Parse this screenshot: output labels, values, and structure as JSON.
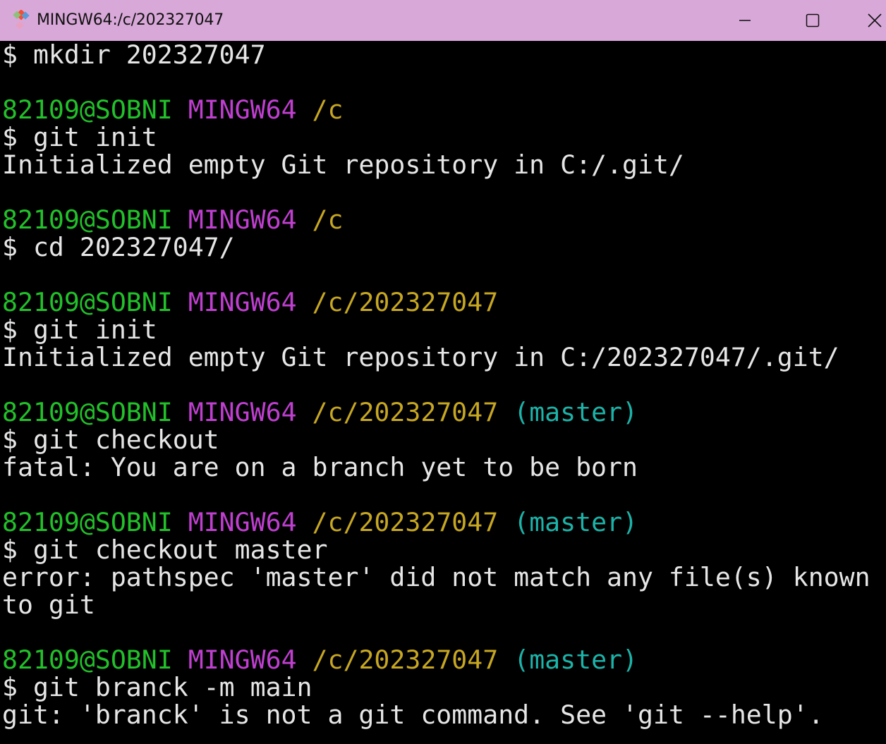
{
  "window": {
    "title": "MINGW64:/c/202327047",
    "colors": {
      "titlebar": "#d8a8d8",
      "background": "#000000",
      "text": "#e6e6e6",
      "user_host": "#22c02a",
      "system": "#bf3fd0",
      "path": "#c7a722",
      "branch": "#1cb3a9"
    }
  },
  "terminal": {
    "lines": [
      {
        "cmd": "$ mkdir 202327047"
      },
      {
        "blank": ""
      },
      {
        "user": "82109@SOBNI",
        "sys": "MINGW64",
        "path": "/c",
        "branch": ""
      },
      {
        "cmd": "$ git init"
      },
      {
        "out": "Initialized empty Git repository in C:/.git/"
      },
      {
        "blank": ""
      },
      {
        "user": "82109@SOBNI",
        "sys": "MINGW64",
        "path": "/c",
        "branch": ""
      },
      {
        "cmd": "$ cd 202327047/"
      },
      {
        "blank": ""
      },
      {
        "user": "82109@SOBNI",
        "sys": "MINGW64",
        "path": "/c/202327047",
        "branch": ""
      },
      {
        "cmd": "$ git init"
      },
      {
        "out": "Initialized empty Git repository in C:/202327047/.git/"
      },
      {
        "blank": ""
      },
      {
        "user": "82109@SOBNI",
        "sys": "MINGW64",
        "path": "/c/202327047",
        "branch": "(master)"
      },
      {
        "cmd": "$ git checkout"
      },
      {
        "out": "fatal: You are on a branch yet to be born"
      },
      {
        "blank": ""
      },
      {
        "user": "82109@SOBNI",
        "sys": "MINGW64",
        "path": "/c/202327047",
        "branch": "(master)"
      },
      {
        "cmd": "$ git checkout master"
      },
      {
        "out": "error: pathspec 'master' did not match any file(s) known"
      },
      {
        "out": "to git"
      },
      {
        "blank": ""
      },
      {
        "user": "82109@SOBNI",
        "sys": "MINGW64",
        "path": "/c/202327047",
        "branch": "(master)"
      },
      {
        "cmd": "$ git branck -m main"
      },
      {
        "out": "git: 'branck' is not a git command. See 'git --help'."
      }
    ]
  }
}
